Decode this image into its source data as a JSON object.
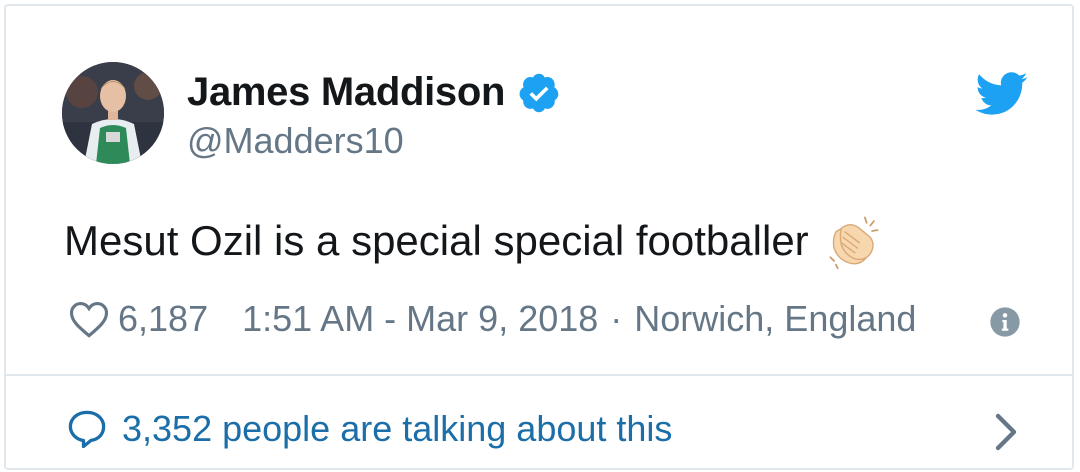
{
  "tweet": {
    "author": {
      "name": "James Maddison",
      "handle": "@Madders10",
      "verified": true,
      "avatar_icon": "profile-photo"
    },
    "text": "Mesut Ozil is a special special footballer",
    "emoji": "clapping-hands",
    "likes": "6,187",
    "timestamp": "1:51 AM - Mar 9, 2018",
    "separator": "·",
    "location": "Norwich, England",
    "talking": "3,352 people are talking about this"
  },
  "icons": {
    "brand": "twitter-bird-icon",
    "like": "heart-outline-icon",
    "info": "info-circle-icon",
    "reply": "speech-bubble-icon",
    "more": "chevron-right-icon",
    "verified": "verified-badge-icon"
  },
  "colors": {
    "brand_blue": "#1da1f2",
    "link_blue": "#1b6ea8",
    "text": "#14171a",
    "secondary": "#657786",
    "border": "#e1e8ed"
  }
}
